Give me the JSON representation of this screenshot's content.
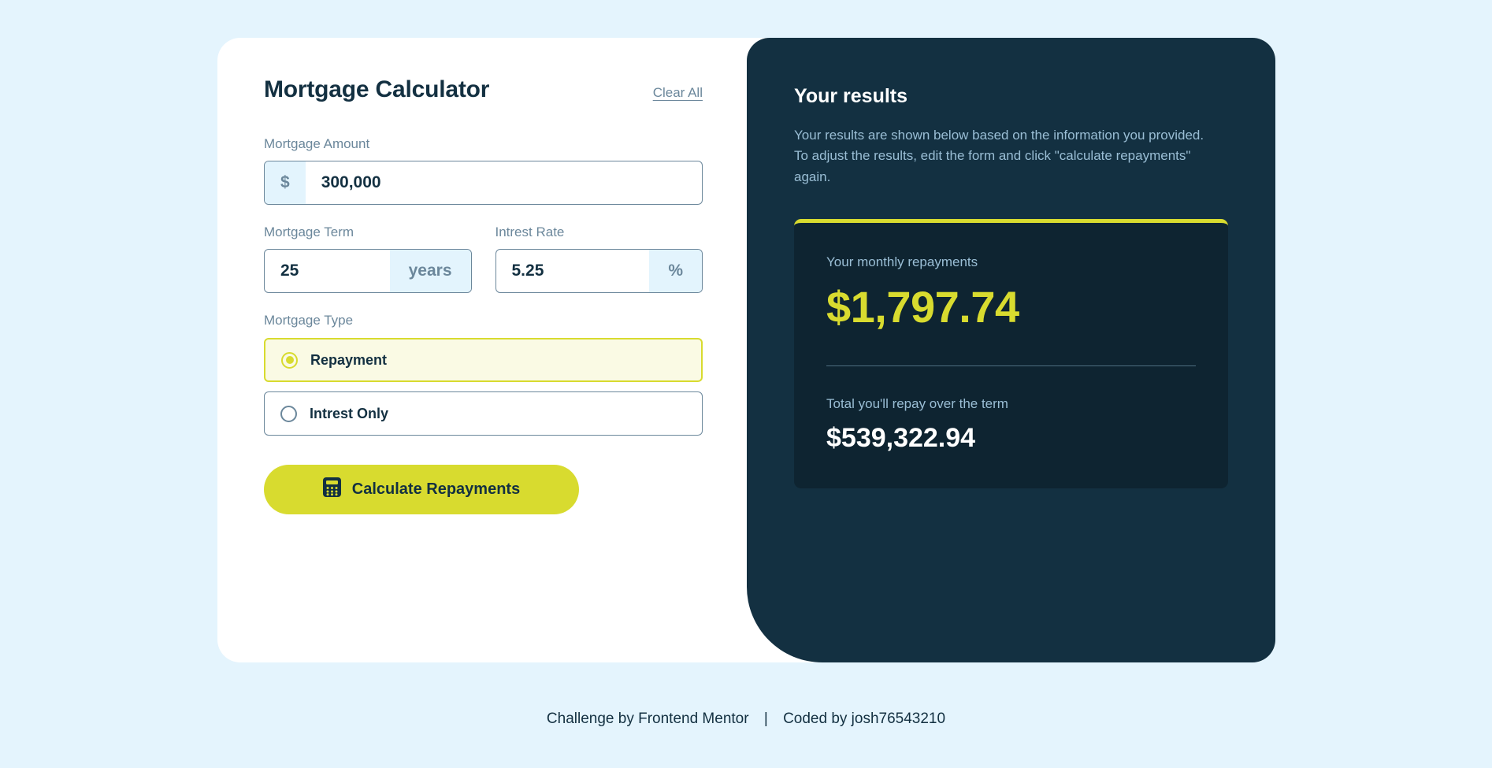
{
  "page": {
    "background_color": "#E4F4FD"
  },
  "form": {
    "title": "Mortgage Calculator",
    "clear_all_label": "Clear All",
    "amount": {
      "label": "Mortgage Amount",
      "prefix": "$",
      "value": "300,000"
    },
    "term": {
      "label": "Mortgage Term",
      "value": "25",
      "suffix": "years"
    },
    "rate": {
      "label": "Intrest Rate",
      "value": "5.25",
      "suffix": "%"
    },
    "mortgage_type": {
      "label": "Mortgage Type",
      "options": [
        {
          "label": "Repayment",
          "selected": true
        },
        {
          "label": "Intrest Only",
          "selected": false
        }
      ]
    },
    "submit_label": "Calculate Repayments"
  },
  "results": {
    "title": "Your results",
    "description": "Your results are shown below based on the information you provided. To adjust the results, edit the form and click \"calculate repayments\" again.",
    "monthly_label": "Your monthly repayments",
    "monthly_value": "$1,797.74",
    "total_label": "Total you'll repay over the term",
    "total_value": "$539,322.94"
  },
  "footer": {
    "challenge_text": "Challenge by Frontend Mentor",
    "separator": "|",
    "coded_by_text": "Coded by josh76543210"
  },
  "colors": {
    "lime": "#D8DB2F",
    "slate900": "#133041",
    "slate800": "#0E2431",
    "slate700": "#4E6E81",
    "slate500": "#6B879B",
    "slate300": "#9ABED5",
    "slate100": "#E3F4FD"
  }
}
